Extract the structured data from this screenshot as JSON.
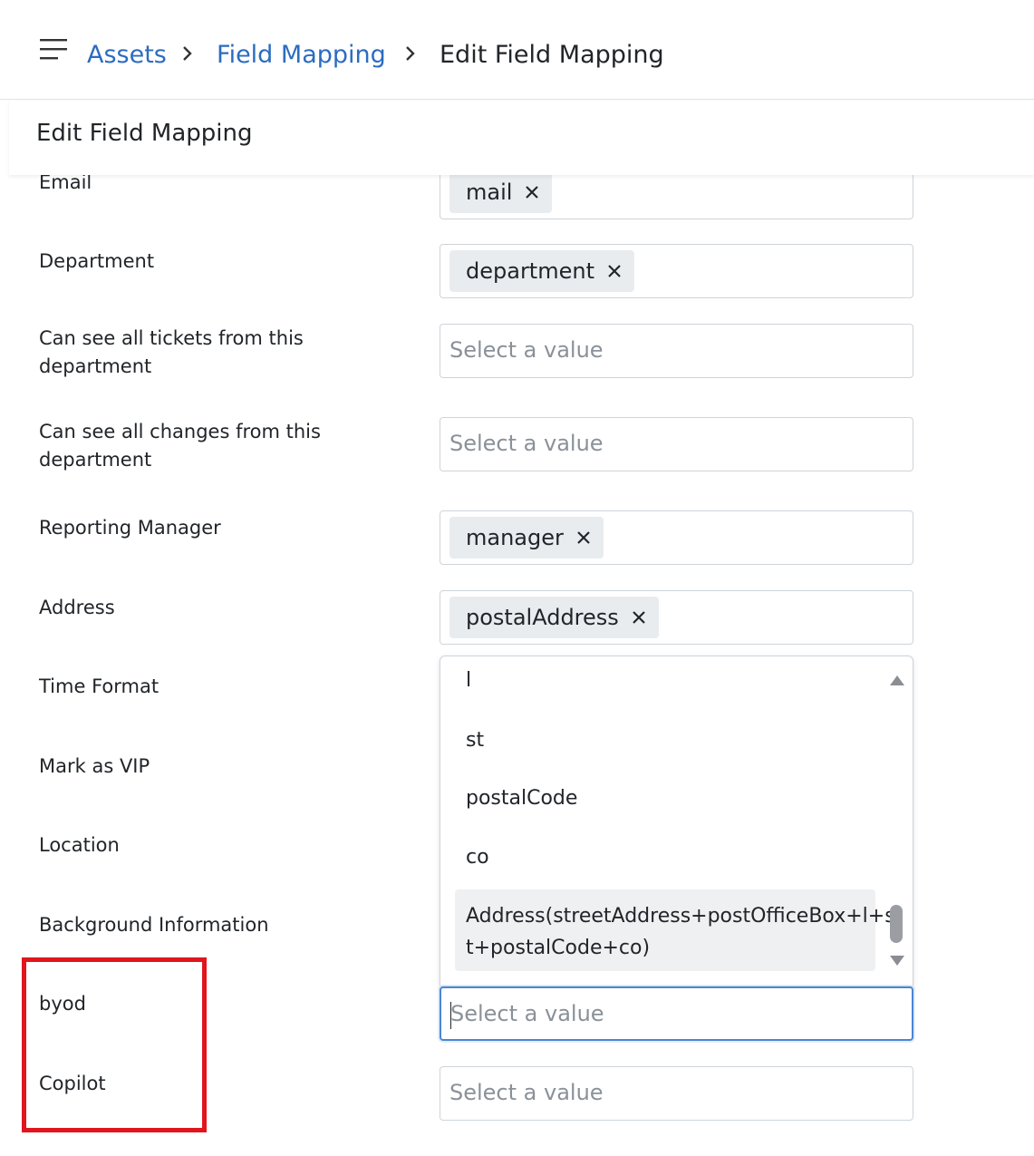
{
  "breadcrumb": {
    "items": [
      "Assets",
      "Field Mapping",
      "Edit Field Mapping"
    ]
  },
  "section": {
    "title": "Edit Field Mapping"
  },
  "fields": {
    "email": {
      "label": "Email",
      "value": "mail"
    },
    "department": {
      "label": "Department",
      "value": "department"
    },
    "tickets_dept": {
      "label": "Can see all tickets from this department",
      "placeholder": "Select a value"
    },
    "changes_dept": {
      "label": "Can see all changes from this department",
      "placeholder": "Select a value"
    },
    "reporting_manager": {
      "label": "Reporting Manager",
      "value": "manager"
    },
    "address": {
      "label": "Address",
      "value": "postalAddress"
    },
    "time_format": {
      "label": "Time Format"
    },
    "mark_vip": {
      "label": "Mark as VIP"
    },
    "location": {
      "label": "Location"
    },
    "background": {
      "label": "Background Information"
    },
    "byod": {
      "label": "byod",
      "placeholder": "Select a value"
    },
    "copilot": {
      "label": "Copilot",
      "placeholder": "Select a value"
    }
  },
  "dropdown": {
    "options": [
      "l",
      "st",
      "postalCode",
      "co",
      "Address(streetAddress+postOfficeBox+l+st+postalCode+co)"
    ],
    "highlight_line1": "Address(streetAddress+postOfficeBox+l+s",
    "highlight_line2": "t+postalCode+co)"
  },
  "colors": {
    "link": "#2b6cc0",
    "annotation": "#e0161f",
    "focus": "#4a86d4"
  }
}
